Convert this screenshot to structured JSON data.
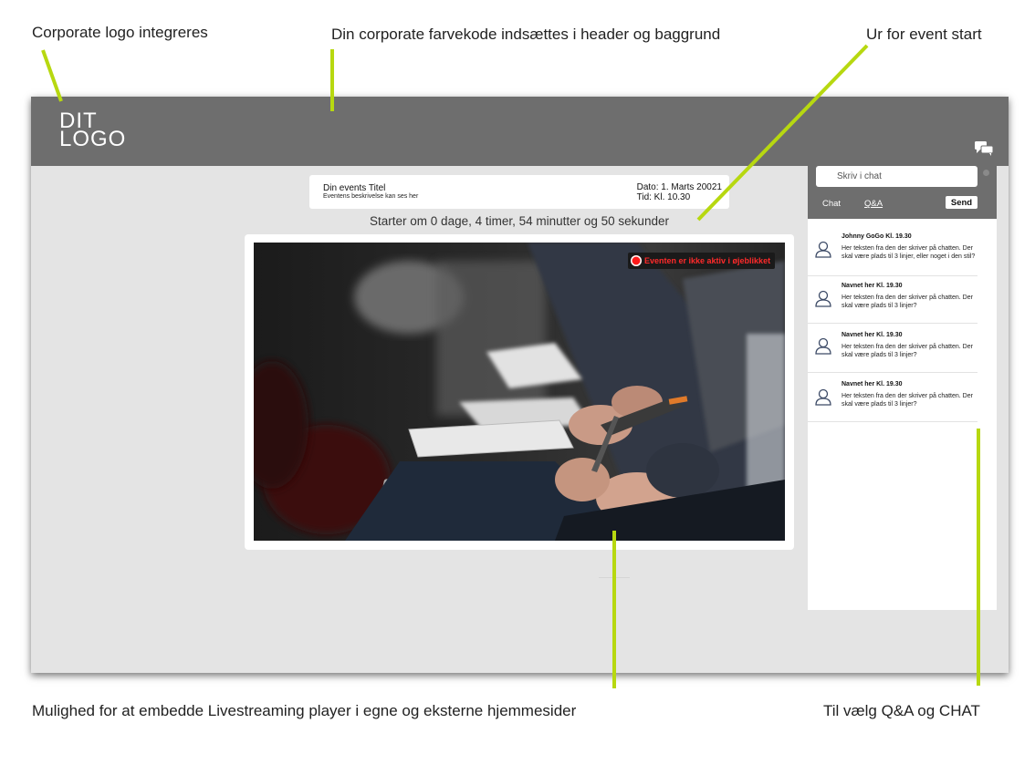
{
  "annotations": {
    "logo": "Corporate logo integreres",
    "colors": "Din corporate farvekode indsættes i header og baggrund",
    "clock": "Ur for event start",
    "embed": "Mulighed for at embedde Livestreaming player i egne og eksterne hjemmesider",
    "qa_chat": "Til vælg Q&A og CHAT"
  },
  "colors": {
    "pointer": "#b7d810",
    "header": "#6e6e6e",
    "background": "#e4e4e4",
    "live_red": "#ff2a2a"
  },
  "header": {
    "logo_line1": "DIT",
    "logo_line2": "LOGO",
    "chat_icon": "chat-bubbles-icon"
  },
  "event": {
    "title": "Din events Titel",
    "description": "Eventens beskrivelse kan ses her",
    "date": "Dato: 1. Marts 20021",
    "time": "Tid: Kl. 10.30",
    "countdown": "Starter om 0 dage, 4 timer, 54 minutter og 50 sekunder"
  },
  "player": {
    "status": "Eventen er ikke aktiv i øjeblikket",
    "image": "audience-taking-notes-photo"
  },
  "chat": {
    "placeholder": "Skriv i chat",
    "tab_chat": "Chat",
    "tab_qa": "Q&A",
    "send": "Send",
    "messages": [
      {
        "author": "Johnny GoGo  Kl. 19.30",
        "text": "Her teksten fra den der skriver på chatten. Der skal være plads til 3 linjer, eller noget i den stil?"
      },
      {
        "author": "Navnet her Kl. 19.30",
        "text": "Her teksten fra den der skriver på chatten. Der skal være plads til 3 linjer?"
      },
      {
        "author": "Navnet her Kl. 19.30",
        "text": "Her teksten fra den der skriver på chatten. Der skal være plads til 3 linjer?"
      },
      {
        "author": "Navnet her Kl. 19.30",
        "text": "Her teksten fra den der skriver på chatten. Der skal være plads til 3 linjer?"
      }
    ]
  }
}
